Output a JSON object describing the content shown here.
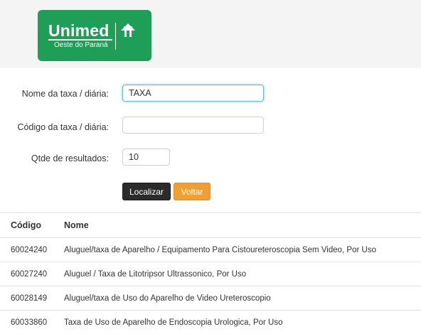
{
  "brand": {
    "name": "Unimed",
    "region": "Oeste do Paraná",
    "color": "#1e9e56"
  },
  "form": {
    "nome_label": "Nome da taxa / diária:",
    "nome_value": "TAXA",
    "codigo_label": "Código da taxa / diária:",
    "codigo_value": "",
    "qtde_label": "Qtde de resultados:",
    "qtde_value": "10",
    "localizar_label": "Localizar",
    "voltar_label": "Voltar"
  },
  "table": {
    "columns": [
      "Código",
      "Nome"
    ],
    "rows": [
      {
        "codigo": "60024240",
        "nome": "Aluguel/taxa de Aparelho / Equipamento Para Cistoureteroscopia Sem Video, Por Uso"
      },
      {
        "codigo": "60027240",
        "nome": "Aluguel / Taxa de Litotripsor Ultrassonico, Por Uso"
      },
      {
        "codigo": "60028149",
        "nome": "Aluguel/taxa de Uso do Aparelho de Video Ureteroscopio"
      },
      {
        "codigo": "60033860",
        "nome": "Taxa de Uso de Aparelho de Endoscopia Urologica, Por Uso"
      }
    ]
  }
}
